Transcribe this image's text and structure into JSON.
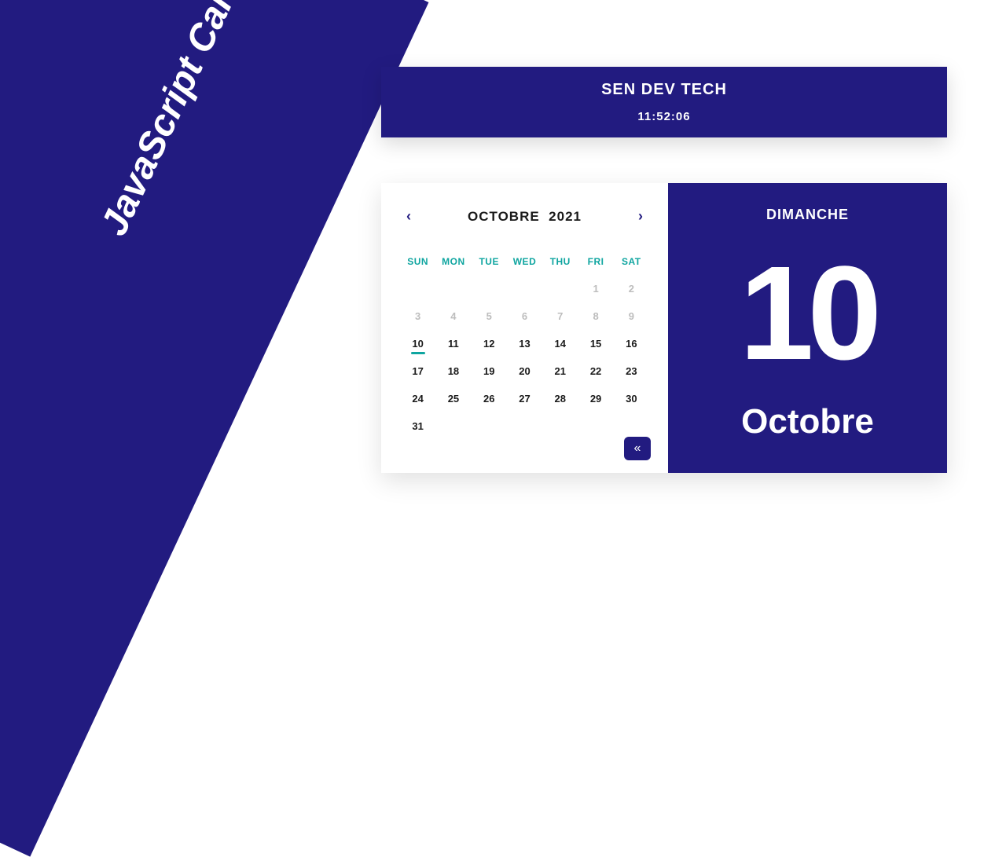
{
  "banner": {
    "title": "JavaScript Calendar"
  },
  "header": {
    "brand": "SEN DEV TECH",
    "time": "11:52:06"
  },
  "calendar": {
    "month_label": "OCTOBRE",
    "year": "2021",
    "weekdays": [
      "SUN",
      "MON",
      "TUE",
      "WED",
      "THU",
      "FRI",
      "SAT"
    ],
    "lead_blanks": 5,
    "prev_tail": [
      "1",
      "2"
    ],
    "days": [
      "3",
      "4",
      "5",
      "6",
      "7",
      "8",
      "9",
      "10",
      "11",
      "12",
      "13",
      "14",
      "15",
      "16",
      "17",
      "18",
      "19",
      "20",
      "21",
      "22",
      "23",
      "24",
      "25",
      "26",
      "27",
      "28",
      "29",
      "30",
      "31"
    ],
    "muted_until_index": 7,
    "today": "10"
  },
  "today_panel": {
    "dayname": "DIMANCHE",
    "daynum": "10",
    "month": "Octobre"
  },
  "icons": {
    "prev": "‹",
    "next": "›",
    "collapse": "«"
  }
}
